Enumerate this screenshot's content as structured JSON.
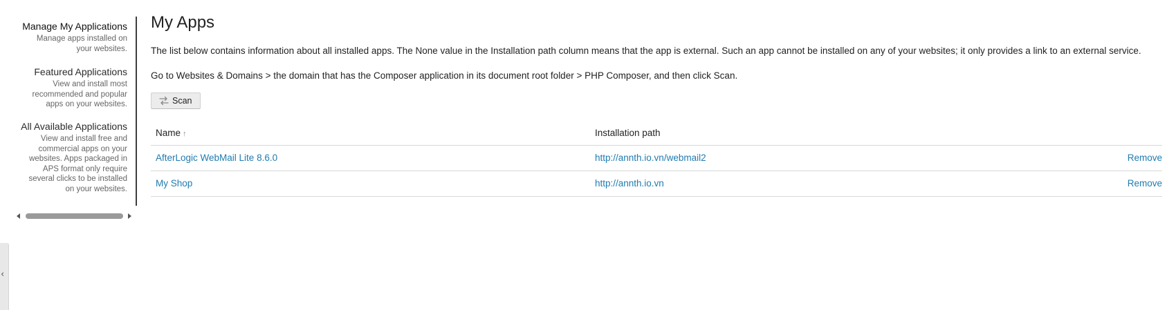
{
  "sidebar": {
    "items": [
      {
        "title": "Manage My Applications",
        "description": "Manage apps installed on your websites."
      },
      {
        "title": "Featured Applications",
        "description": "View and install most recommended and popular apps on your websites."
      },
      {
        "title": "All Available Applications",
        "description": "View and install free and commercial apps on your websites. Apps packaged in APS format only require several clicks to be installed on your websites."
      }
    ],
    "collapse_glyph": "‹"
  },
  "main": {
    "title": "My Apps",
    "paragraph1": "The list below contains information about all installed apps. The None value in the Installation path column means that the app is external. Such an app cannot be installed on any of your websites; it only provides a link to an external service.",
    "paragraph2": "Go to Websites & Domains > the domain that has the Composer application in its document root folder > PHP Composer, and then click Scan.",
    "scan_button": {
      "label": "Scan",
      "icon": "scan-arrows-icon"
    },
    "table": {
      "columns": {
        "name": "Name",
        "path": "Installation path"
      },
      "sort_indicator": "↑",
      "rows": [
        {
          "name": "AfterLogic WebMail Lite 8.6.0",
          "path": "http://annth.io.vn/webmail2",
          "action": "Remove"
        },
        {
          "name": "My Shop",
          "path": "http://annth.io.vn",
          "action": "Remove"
        }
      ]
    }
  },
  "colors": {
    "link": "#1f7bb0",
    "text": "#222222",
    "muted": "#666666"
  }
}
